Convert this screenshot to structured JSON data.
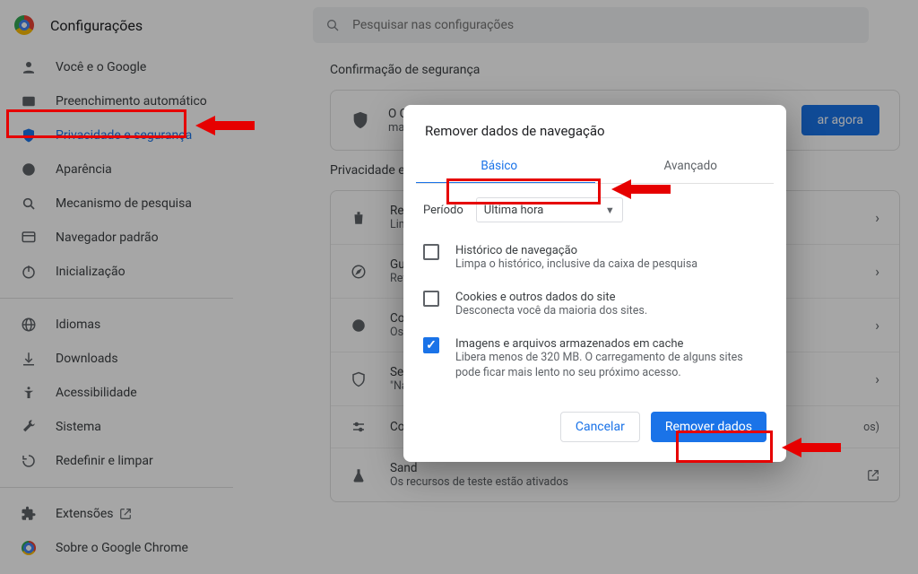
{
  "header": {
    "title": "Configurações",
    "search_placeholder": "Pesquisar nas configurações"
  },
  "sidebar": {
    "items": [
      {
        "label": "Você e o Google"
      },
      {
        "label": "Preenchimento automático"
      },
      {
        "label": "Privacidade e segurança"
      },
      {
        "label": "Aparência"
      },
      {
        "label": "Mecanismo de pesquisa"
      },
      {
        "label": "Navegador padrão"
      },
      {
        "label": "Inicialização"
      }
    ],
    "group2": [
      {
        "label": "Idiomas"
      },
      {
        "label": "Downloads"
      },
      {
        "label": "Acessibilidade"
      },
      {
        "label": "Sistema"
      },
      {
        "label": "Redefinir e limpar"
      }
    ],
    "group3": [
      {
        "label": "Extensões"
      },
      {
        "label": "Sobre o Google Chrome"
      }
    ]
  },
  "safety": {
    "heading": "Confirmação de segurança",
    "line1": "O Ch",
    "line2": "mali",
    "button": "ar agora"
  },
  "privacy": {
    "heading": "Privacidade e",
    "rows": [
      {
        "t1": "Rem",
        "t2": "Limp"
      },
      {
        "t1": "Guia",
        "t2": "Revis"
      },
      {
        "t1": "Cook",
        "t2": "Os"
      },
      {
        "t1": "Segu",
        "t2": "\"Nav"
      },
      {
        "t1": "Conf",
        "t2": ""
      },
      {
        "t1": "Sand",
        "t2": "Os recursos de teste estão ativados"
      }
    ],
    "trail": "os)"
  },
  "dialog": {
    "title": "Remover dados de navegação",
    "tab_basic": "Básico",
    "tab_advanced": "Avançado",
    "period_label": "Período",
    "period_value": "Última hora",
    "opts": [
      {
        "t": "Histórico de navegação",
        "d": "Limpa o histórico, inclusive da caixa de pesquisa",
        "checked": false
      },
      {
        "t": "Cookies e outros dados do site",
        "d": "Desconecta você da maioria dos sites.",
        "checked": false
      },
      {
        "t": "Imagens e arquivos armazenados em cache",
        "d": "Libera menos de 320 MB. O carregamento de alguns sites pode ficar mais lento no seu próximo acesso.",
        "checked": true
      }
    ],
    "cancel": "Cancelar",
    "confirm": "Remover dados"
  }
}
